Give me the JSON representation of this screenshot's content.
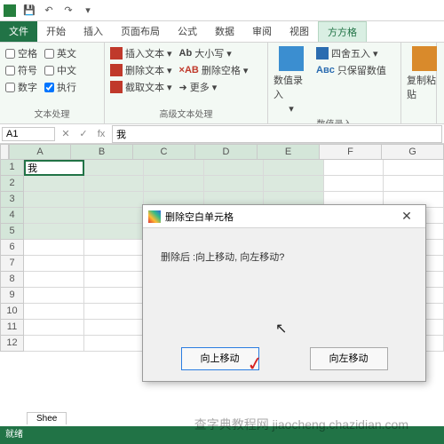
{
  "qat": {
    "save": "💾",
    "undo": "↶",
    "redo": "↷",
    "more": "▾"
  },
  "tabs": {
    "file": "文件",
    "home": "开始",
    "insert": "插入",
    "layout": "页面布局",
    "formula": "公式",
    "data": "数据",
    "review": "审阅",
    "view": "视图",
    "fangfang": "方方格"
  },
  "ribbon": {
    "textproc": {
      "chk_space": "空格",
      "chk_en": "英文",
      "chk_symbol": "符号",
      "chk_cn": "中文",
      "chk_num": "数字",
      "chk_exec": "执行",
      "label": "文本处理"
    },
    "advtext": {
      "insert_text": "插入文本",
      "case": "大小写",
      "delete_text": "删除文本",
      "del_space": "删除空格",
      "extract_text": "截取文本",
      "more": "更多",
      "label": "高级文本处理"
    },
    "datainput": {
      "big": "数值录入",
      "round": "四舍五入",
      "keepnum": "只保留数值",
      "label": "数值录入"
    },
    "paste": {
      "label": "复制粘贴"
    }
  },
  "namebox": "A1",
  "fx": "fx",
  "formula_value": "我",
  "cols": [
    "A",
    "B",
    "C",
    "D",
    "E",
    "F",
    "G"
  ],
  "rows": [
    "1",
    "2",
    "3",
    "4",
    "5",
    "6",
    "7",
    "8",
    "9",
    "10",
    "11",
    "12"
  ],
  "cell_a1": "我",
  "sheet": "Shee",
  "status": "就绪",
  "watermark": "查字典教程网 jiaocheng.chazidian.com",
  "dialog": {
    "title": "删除空白单元格",
    "message": "删除后 :向上移动, 向左移动?",
    "btn_up": "向上移动",
    "btn_left": "向左移动",
    "close": "✕"
  }
}
